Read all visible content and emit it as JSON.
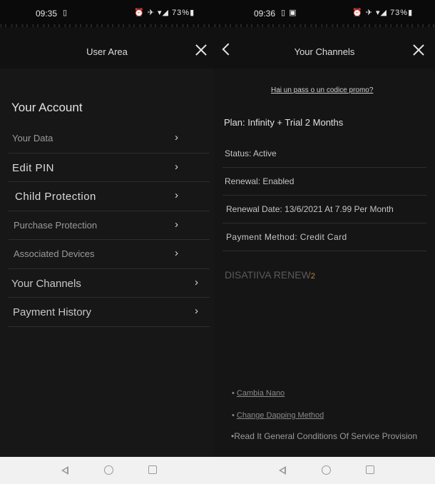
{
  "left": {
    "status": {
      "time": "09:35",
      "icons": "⏰ ✈ ▾◢ 73%▮",
      "battery": "73%"
    },
    "header": {
      "title": "User Area"
    },
    "section_title": "Your Account",
    "menu": [
      {
        "label": "Your Data",
        "chevron": "›"
      },
      {
        "label": "Edit PIN",
        "chevron": "›"
      },
      {
        "label": "Child Protection",
        "chevron": "›"
      },
      {
        "label": "Purchase Protection",
        "chevron": "›"
      },
      {
        "label": "Associated Devices",
        "chevron": "›"
      },
      {
        "label": "Your Channels",
        "chevron": "›"
      },
      {
        "label": "Payment History",
        "chevron": "›"
      }
    ]
  },
  "right": {
    "status": {
      "time": "09:36",
      "icons": "⏰ ✈ ▾◢ 73%▮"
    },
    "header": {
      "title": "Your Channels"
    },
    "promo_link": "Hai un pass o un codice promo?",
    "plan": "Plan: Infinity + Trial 2 Months",
    "details": [
      "Status: Active",
      "Renewal: Enabled",
      "Renewal Date: 13/6/2021 At 7.99 Per Month",
      "Payment Method: Credit Card"
    ],
    "disable_label": "DISATIIVA RENEW",
    "disable_badge": "2",
    "bullets": [
      "Cambia Nano",
      "Change Dapping Method",
      "Read It General Conditions Of Service Provision"
    ]
  },
  "colors": {
    "background": "#171717",
    "accent": "#c9843a",
    "navbar": "#f1f1f1"
  }
}
